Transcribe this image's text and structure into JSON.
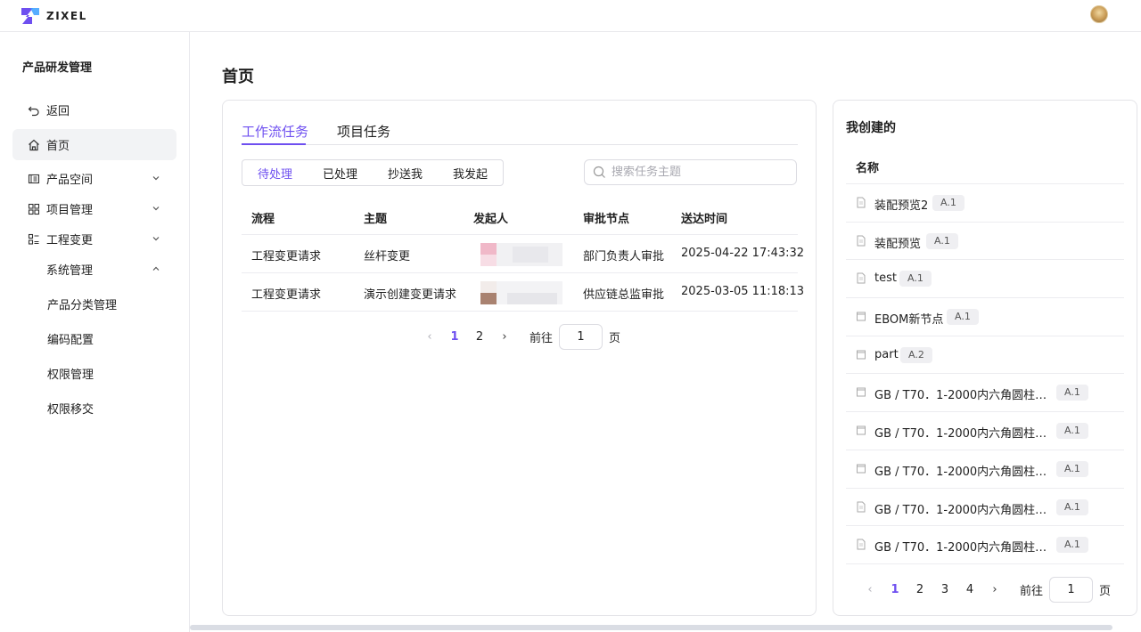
{
  "app": {
    "logo_text": "ZIXEL"
  },
  "sidebar": {
    "title": "产品研发管理",
    "items": [
      {
        "label": "返回",
        "icon": "back-arrow-icon"
      },
      {
        "label": "首页",
        "icon": "home-icon"
      },
      {
        "label": "产品空间",
        "icon": "product-space-icon"
      },
      {
        "label": "项目管理",
        "icon": "grid-icon"
      },
      {
        "label": "工程变更",
        "icon": "change-list-icon"
      }
    ],
    "subgroup": "系统管理",
    "subitems": [
      "产品分类管理",
      "编码配置",
      "权限管理",
      "权限移交"
    ]
  },
  "main": {
    "title": "首页",
    "tabs": [
      "工作流任务",
      "项目任务"
    ],
    "filters": [
      "待处理",
      "已处理",
      "抄送我",
      "我发起"
    ],
    "search_placeholder": "搜索任务主题",
    "columns": [
      "流程",
      "主题",
      "发起人",
      "审批节点",
      "送达时间"
    ],
    "rows": [
      {
        "flow": "工程变更请求",
        "subject": "丝杆变更",
        "node": "部门负责人审批",
        "time": "2025-04-22 17:43:32"
      },
      {
        "flow": "工程变更请求",
        "subject": "演示创建变更请求",
        "node": "供应链总监审批",
        "time": "2025-03-05 11:18:13"
      }
    ],
    "pager": {
      "pages": [
        "1",
        "2"
      ],
      "current": "1",
      "goto_label": "前往",
      "goto_value": "1",
      "page_suffix": "页"
    }
  },
  "created": {
    "title": "我创建的",
    "column": "名称",
    "items": [
      {
        "name": "装配预览2",
        "version": "A.1"
      },
      {
        "name": "装配预览",
        "version": "A.1"
      },
      {
        "name": "test",
        "version": "A.1"
      },
      {
        "name": "EBOM新节点",
        "version": "A.1"
      },
      {
        "name": "part",
        "version": "A.2"
      },
      {
        "name": "GB / T70．1-2000内六角圆柱头…",
        "version": "A.1"
      },
      {
        "name": "GB / T70．1-2000内六角圆柱头…",
        "version": "A.1"
      },
      {
        "name": "GB / T70．1-2000内六角圆柱头…",
        "version": "A.1"
      },
      {
        "name": "GB / T70．1-2000内六角圆柱头…",
        "version": "A.1"
      },
      {
        "name": "GB / T70．1-2000内六角圆柱头…",
        "version": "A.1"
      }
    ],
    "pager": {
      "pages": [
        "1",
        "2",
        "3",
        "4"
      ],
      "current": "1",
      "goto_label": "前往",
      "goto_value": "1",
      "page_suffix": "页"
    }
  },
  "colors": {
    "accent": "#6e4ff0"
  }
}
